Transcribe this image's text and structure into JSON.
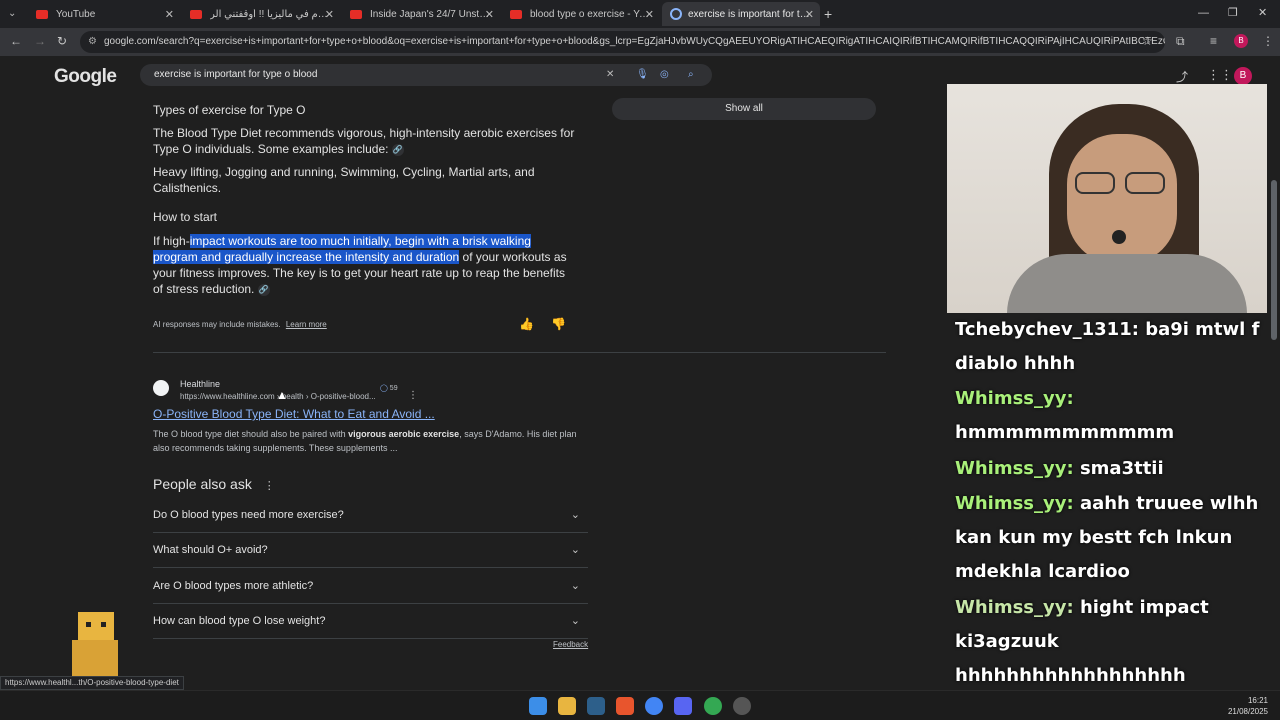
{
  "tabs": [
    {
      "title": "YouTube"
    },
    {
      "title": "اول يوم في ماليزيا !! أوقفتني الر"
    },
    {
      "title": "Inside Japan's 24/7 Unstaffed T"
    },
    {
      "title": "blood type o exercise - YouTub"
    },
    {
      "title": "exercise is important for type o"
    }
  ],
  "address": {
    "url": "google.com/search?q=exercise+is+important+for+type+o+blood&oq=exercise+is+important+for+type+o+blood&gs_lcrp=EgZjaHJvbWUyCQgAEEUYORigATIHCAEQIRigATIHCAIQIRifBTIHCAMQIRifBTIHCAQQIRiPAjIHCAUQIRiPAtIBCTEzODA2ajBqN..."
  },
  "google": {
    "logo": "Google",
    "query": "exercise is important for type o blood",
    "avatar": "B"
  },
  "ai_overview": {
    "section_title": "Types of exercise for Type O",
    "p1": "The Blood Type Diet recommends vigorous, high-intensity aerobic exercises for Type O individuals. Some examples include:",
    "p2": "Heavy lifting, Jogging and running, Swimming, Cycling, Martial arts, and Calisthenics.",
    "how_title": "How to start",
    "how_a": "If high-",
    "how_hl": "impact workouts are too much initially, begin with a brisk walking program and gradually increase the intensity and duration",
    "how_b": " of your workouts as your fitness improves. The key is to get your heart rate up to reap the benefits of stress reduction.",
    "disclaimer": "AI responses may include mistakes.",
    "learn_more": "Learn more",
    "show_all": "Show all"
  },
  "result": {
    "site": "Healthline",
    "breadcrumb": "https://www.healthline.com › health › O-positive-blood...",
    "badge_count": "59",
    "title": "O-Positive Blood Type Diet: What to Eat and Avoid ...",
    "snippet_a": "The O blood type diet should also be paired with ",
    "snippet_bold": "vigorous aerobic exercise",
    "snippet_b": ", says D'Adamo. His diet plan also recommends taking supplements. These supplements ..."
  },
  "paa": {
    "title": "People also ask",
    "questions": [
      "Do O blood types need more exercise?",
      "What should O+ avoid?",
      "Are O blood types more athletic?",
      "How can blood type O lose weight?"
    ],
    "feedback": "Feedback"
  },
  "status_url": "https://www.healthl...th/O-positive-blood-type-diet",
  "chat": [
    {
      "user": "Tchebychev_1311:",
      "msg": " ba9i mtwl f diablo hhhh"
    },
    {
      "user": "Whimss_yy:",
      "msg": " hmmmmmmmmmmm"
    },
    {
      "user": "Whimss_yy:",
      "msg": " sma3ttii"
    },
    {
      "user": "Whimss_yy:",
      "msg": " aahh truuee wlhh kan kun my bestt fch lnkun mdekhla lcardioo"
    },
    {
      "user": "Whimss_yy:",
      "msg": " hight impact ki3agzuuk hhhhhhhhhhhhhhhhhh"
    }
  ],
  "clock": {
    "time": "16:21",
    "date": "21/08/2025"
  },
  "colors": {
    "accent": "#8ab4f8",
    "highlight": "#1a56c9",
    "chat_user": "#a9f07a"
  }
}
